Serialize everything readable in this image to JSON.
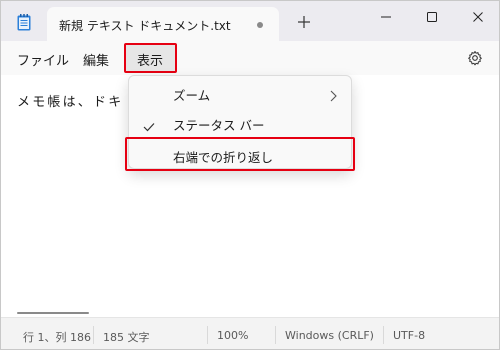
{
  "titlebar": {
    "tab_title": "新規 テキスト ドキュメント.txt",
    "new_tab_icon": "plus-icon",
    "window_controls": [
      "minimize-icon",
      "maximize-icon",
      "close-icon"
    ]
  },
  "menubar": {
    "file": "ファイル",
    "edit": "編集",
    "view": "表示",
    "settings_icon": "gear-icon"
  },
  "editor": {
    "text": "メモ帳は、ドキ                              的なテキスト編集プロ"
  },
  "view_menu": {
    "items": [
      {
        "label": "ズーム",
        "has_submenu": true
      },
      {
        "label": "ステータス バー",
        "checked": true
      },
      {
        "label": "右端での折り返し",
        "checked": false
      }
    ]
  },
  "statusbar": {
    "position": "行 1、列 186",
    "char_count": "185 文字",
    "zoom": "100%",
    "line_ending": "Windows (CRLF)",
    "encoding": "UTF-8"
  },
  "colors": {
    "highlight_box": "#e60012",
    "titlebar_bg": "#ecebf0",
    "menu_bg": "#f9f9f9"
  }
}
